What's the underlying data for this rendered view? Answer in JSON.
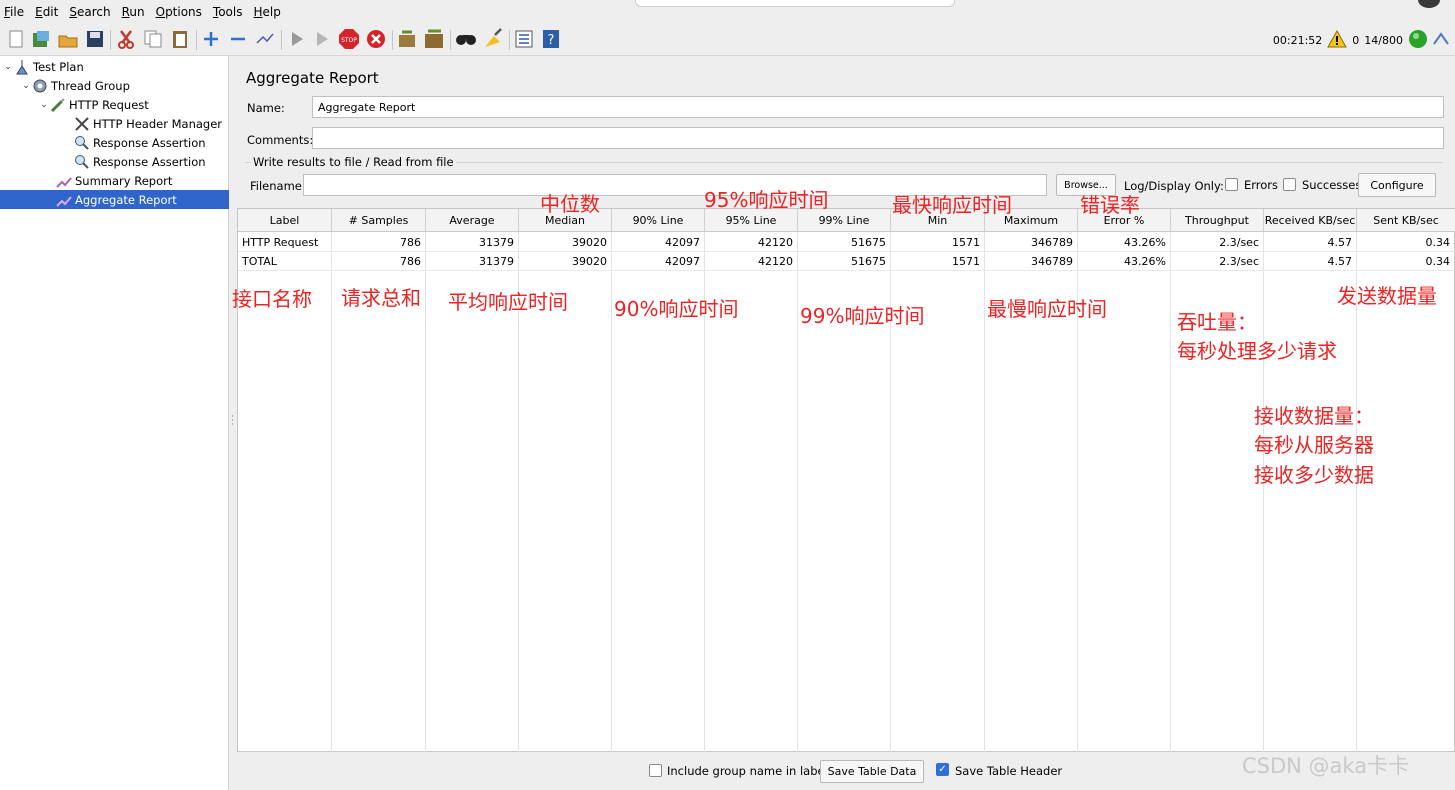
{
  "menubar": {
    "items": [
      "File",
      "Edit",
      "Search",
      "Run",
      "Options",
      "Tools",
      "Help"
    ]
  },
  "toolbar": {
    "icons": [
      "new-icon",
      "templates-icon",
      "open-icon",
      "save-icon",
      "cut-icon",
      "copy-icon",
      "paste-icon",
      "expand-icon",
      "collapse-icon",
      "toggle-icon",
      "start-icon",
      "start-no-pause-icon",
      "stop-icon",
      "shutdown-icon",
      "clear-icon",
      "clear-all-icon",
      "search-icon",
      "reset-search-icon",
      "function-helper-icon",
      "help-icon"
    ]
  },
  "status": {
    "elapsed": "00:21:52",
    "warnings": "0",
    "threads": "14/800"
  },
  "tree": {
    "items": [
      {
        "label": "Test Plan"
      },
      {
        "label": "Thread Group"
      },
      {
        "label": "HTTP Request"
      },
      {
        "label": "HTTP Header Manager"
      },
      {
        "label": "Response Assertion"
      },
      {
        "label": "Response Assertion"
      },
      {
        "label": "Summary Report"
      },
      {
        "label": "Aggregate Report"
      }
    ]
  },
  "panel": {
    "title": "Aggregate Report",
    "name_label": "Name:",
    "name_value": "Aggregate Report",
    "comments_label": "Comments:",
    "comments_value": "",
    "group_title": "Write results to file / Read from file",
    "filename_label": "Filename",
    "filename_value": "",
    "browse_label": "Browse...",
    "log_display_label": "Log/Display Only:",
    "errors_label": "Errors",
    "successes_label": "Successes",
    "configure_label": "Configure"
  },
  "table": {
    "columns": [
      "Label",
      "# Samples",
      "Average",
      "Median",
      "90% Line",
      "95% Line",
      "99% Line",
      "Min",
      "Maximum",
      "Error %",
      "Throughput",
      "Received KB/sec",
      "Sent KB/sec"
    ],
    "rows": [
      [
        "HTTP Request",
        "786",
        "31379",
        "39020",
        "42097",
        "42120",
        "51675",
        "1571",
        "346789",
        "43.26%",
        "2.3/sec",
        "4.57",
        "0.34"
      ],
      [
        "TOTAL",
        "786",
        "31379",
        "39020",
        "42097",
        "42120",
        "51675",
        "1571",
        "346789",
        "43.26%",
        "2.3/sec",
        "4.57",
        "0.34"
      ]
    ]
  },
  "bottom": {
    "include_group_label": "Include group name in label?",
    "save_table_data": "Save Table Data",
    "save_table_header": "Save Table Header"
  },
  "annotations": {
    "median": "中位数",
    "line95": "95%响应时间",
    "min": "最快响应时间",
    "error": "错误率",
    "label": "接口名称",
    "samples": "请求总和",
    "average": "平均响应时间",
    "line90": "90%响应时间",
    "line99": "99%响应时间",
    "max": "最慢响应时间",
    "sent": "发送数据量",
    "throughput_1": "吞吐量：",
    "throughput_2": "每秒处理多少请求",
    "received_1": "接收数据量：",
    "received_2": "每秒从服务器",
    "received_3": "接收多少数据"
  },
  "watermark": "CSDN @aka卡卡",
  "colors": {
    "selection": "#2f65ca",
    "annotation": "#ee2222",
    "background": "#eeeeee"
  }
}
